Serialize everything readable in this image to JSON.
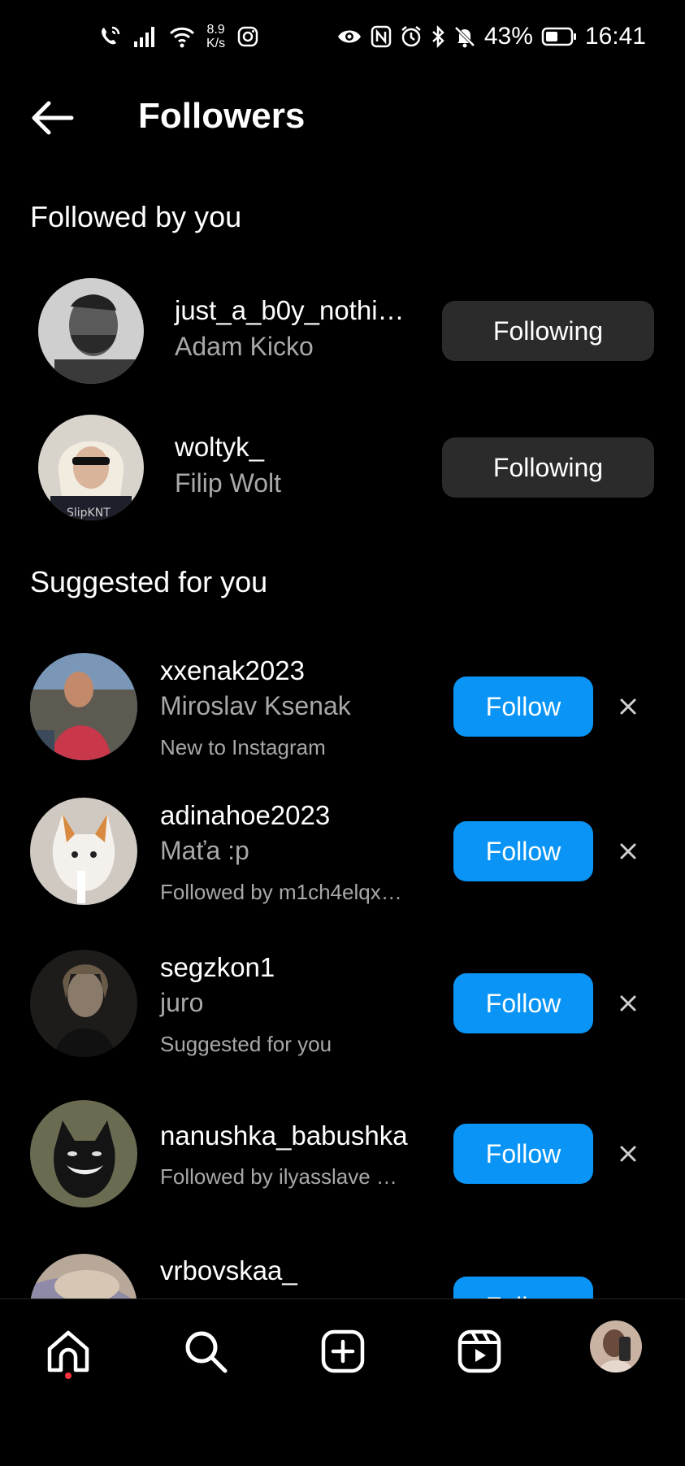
{
  "status_bar": {
    "net_speed_value": "8.9",
    "net_speed_unit": "K/s",
    "battery": "43%",
    "time": "16:41",
    "icons_left": [
      "phone-wifi-icon",
      "signal-icon",
      "wifi-icon",
      "instagram-notification-icon"
    ],
    "icons_right": [
      "eye-icon",
      "nfc-icon",
      "alarm-icon",
      "bluetooth-icon",
      "mute-icon",
      "battery-icon"
    ]
  },
  "header": {
    "title": "Followers"
  },
  "sections": {
    "followed_title": "Followed by you",
    "suggested_title": "Suggested for you"
  },
  "followed": [
    {
      "username": "just_a_b0y_nothi…",
      "full_name": "Adam Kicko",
      "button": "Following"
    },
    {
      "username": "woltyk_",
      "full_name": "Filip Wolt",
      "button": "Following"
    }
  ],
  "suggested": [
    {
      "username": "xxenak2023",
      "full_name": "Miroslav Ksenak",
      "subtitle": "New to Instagram",
      "button": "Follow"
    },
    {
      "username": "adinahoe2023",
      "full_name": "Maťa :p",
      "subtitle": "Followed by m1ch4elqx…",
      "button": "Follow"
    },
    {
      "username": "segzkon1",
      "full_name": "juro",
      "subtitle": "Suggested for you",
      "button": "Follow"
    },
    {
      "username": "nanushka_babushka",
      "full_name": "",
      "subtitle": "Followed by ilyasslave …",
      "button": "Follow"
    },
    {
      "username": "vrbovskaa_",
      "full_name": "",
      "subtitle": "",
      "button": "Follow"
    }
  ],
  "bottom_nav": [
    "home-icon",
    "search-icon",
    "create-icon",
    "reels-icon",
    "profile-avatar"
  ],
  "colors": {
    "background": "#000000",
    "follow_blue": "#0a95f6",
    "following_gray": "#2b2b2b",
    "secondary_text": "#a8a8a8",
    "notification_dot": "#ff3040"
  }
}
